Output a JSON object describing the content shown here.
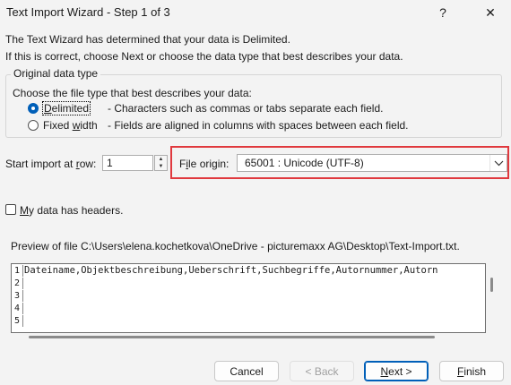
{
  "window": {
    "title": "Text Import Wizard - Step 1 of 3",
    "help": "?",
    "close": "✕"
  },
  "intro": {
    "line1": "The Text Wizard has determined that your data is Delimited.",
    "line2": "If this is correct, choose Next or choose the data type that best describes your data."
  },
  "data_type": {
    "legend": "Original data type",
    "prompt": "Choose the file type that best describes your data:",
    "options": [
      {
        "label_pre": "",
        "label_ul": "D",
        "label_post": "elimited",
        "desc": "- Characters such as commas or tabs separate each field.",
        "selected": true
      },
      {
        "label_pre": "Fixed ",
        "label_ul": "w",
        "label_post": "idth",
        "desc": "- Fields are aligned in columns with spaces between each field.",
        "selected": false
      }
    ]
  },
  "start_row": {
    "label_pre": "Start import at ",
    "label_ul": "r",
    "label_post": "ow:",
    "value": "1"
  },
  "file_origin": {
    "label_pre": "F",
    "label_ul": "i",
    "label_post": "le origin:",
    "value": "65001 : Unicode (UTF-8)"
  },
  "headers": {
    "label_ul": "M",
    "label_post": "y data has headers.",
    "checked": false
  },
  "preview": {
    "label": "Preview of file C:\\Users\\elena.kochetkova\\OneDrive - picturemaxx AG\\Desktop\\Text-Import.txt.",
    "rows": [
      {
        "n": "1",
        "text": "Dateiname,Objektbeschreibung,Ueberschrift,Suchbegriffe,Autornummer,Autorn"
      },
      {
        "n": "2",
        "text": ""
      },
      {
        "n": "3",
        "text": ""
      },
      {
        "n": "4",
        "text": ""
      },
      {
        "n": "5",
        "text": ""
      }
    ]
  },
  "buttons": {
    "cancel": "Cancel",
    "back": "< Back",
    "next_pre": "",
    "next_ul": "N",
    "next_post": "ext >",
    "finish_pre": "",
    "finish_ul": "F",
    "finish_post": "inish"
  },
  "colors": {
    "accent": "#005fb8",
    "highlight_box": "#e0393e"
  }
}
